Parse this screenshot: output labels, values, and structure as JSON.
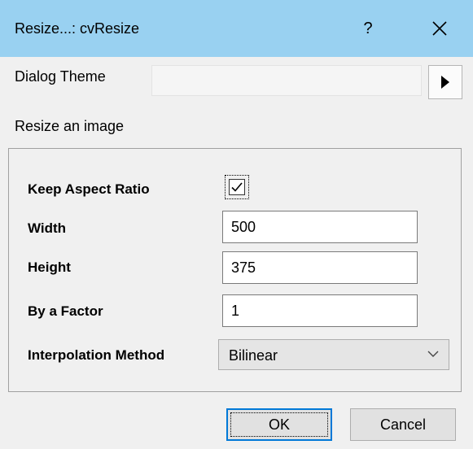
{
  "window": {
    "title": "Resize...: cvResize",
    "help_label": "?",
    "close_icon": "close-icon"
  },
  "theme": {
    "label": "Dialog Theme",
    "value": "",
    "arrow_icon": "triangle-right-icon"
  },
  "description": "Resize an image",
  "form": {
    "keep_aspect_label": "Keep Aspect Ratio",
    "keep_aspect_checked": true,
    "width_label": "Width",
    "width_value": "500",
    "height_label": "Height",
    "height_value": "375",
    "factor_label": "By a Factor",
    "factor_value": "1",
    "interp_label": "Interpolation Method",
    "interp_value": "Bilinear",
    "interp_icon": "chevron-down-icon"
  },
  "buttons": {
    "ok": "OK",
    "cancel": "Cancel"
  },
  "colors": {
    "titlebar": "#99d1f1",
    "background": "#f0f0f0",
    "focus_border": "#0078d7"
  }
}
